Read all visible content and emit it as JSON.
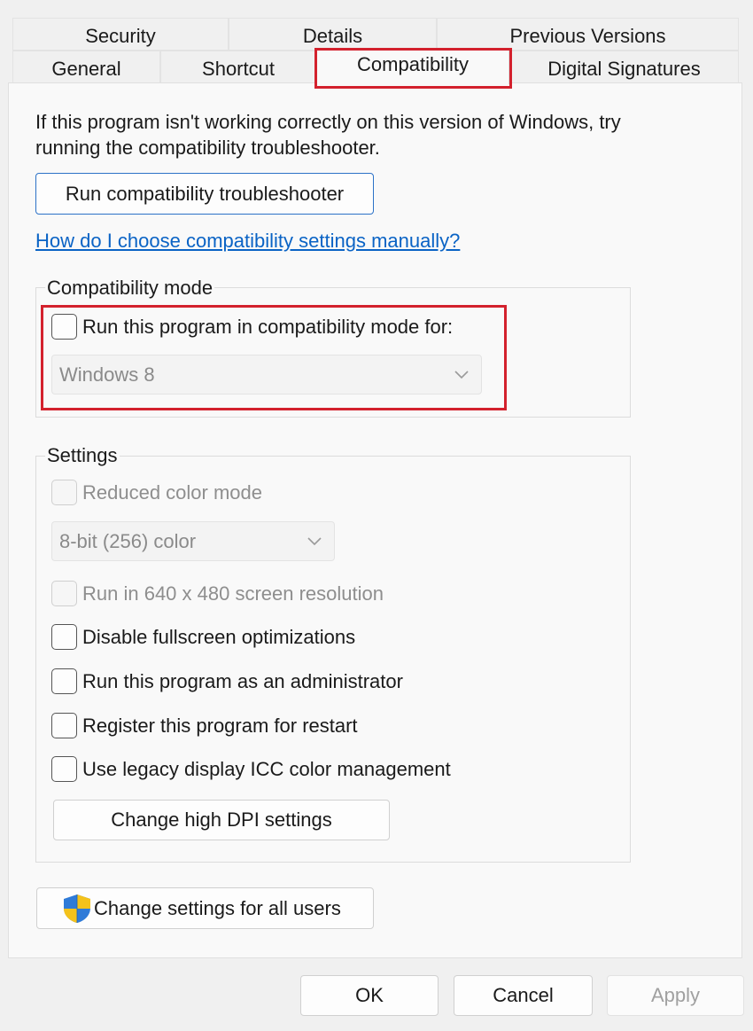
{
  "tabs": {
    "row1": [
      "Security",
      "Details",
      "Previous Versions"
    ],
    "row2": [
      "General",
      "Shortcut",
      "Compatibility",
      "Digital Signatures"
    ]
  },
  "intro": {
    "line1": "If this program isn't working correctly on this version of Windows, try",
    "line2": "running the compatibility troubleshooter."
  },
  "troubleshooter_button": "Run compatibility troubleshooter",
  "manual_link": "How do I choose compatibility settings manually? ",
  "compat_mode": {
    "label": "Compatibility mode",
    "checkbox_label": "Run this program in compatibility mode for:",
    "checked": false,
    "selected_os": "Windows 8"
  },
  "settings": {
    "label": "Settings",
    "reduced_color": {
      "label": "Reduced color mode",
      "checked": false,
      "disabled": true
    },
    "color_depth": "8-bit (256) color",
    "res_640": {
      "label": "Run in 640 x 480 screen resolution",
      "checked": false,
      "disabled": true
    },
    "fullscreen_opt": {
      "label": "Disable fullscreen optimizations",
      "checked": false
    },
    "run_admin": {
      "label": "Run this program as an administrator",
      "checked": false
    },
    "register_restart": {
      "label": "Register this program for restart",
      "checked": false
    },
    "legacy_icc": {
      "label": "Use legacy display ICC color management",
      "checked": false
    },
    "dpi_button": "Change high DPI settings"
  },
  "all_users_button": "Change settings for all users",
  "footer": {
    "ok": "OK",
    "cancel": "Cancel",
    "apply": "Apply"
  },
  "colors": {
    "highlight": "#d3212d",
    "link": "#0a63c5",
    "accent": "#2c72c7"
  },
  "icons": {
    "shield": "uac-shield-icon",
    "dropdown": "chevron-down-icon"
  }
}
